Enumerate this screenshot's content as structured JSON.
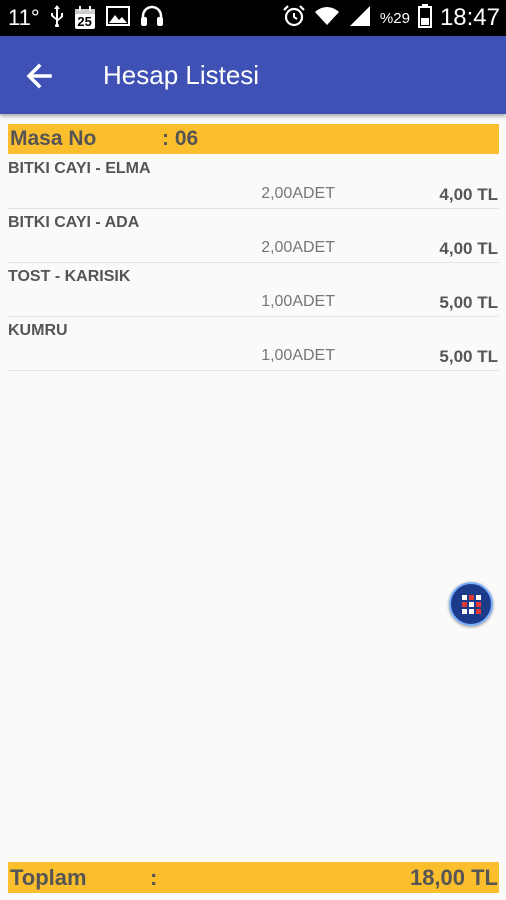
{
  "status_bar": {
    "temperature": "11°",
    "calendar_day": "25",
    "battery_percent": "%29",
    "time": "18:47"
  },
  "app_bar": {
    "title": "Hesap Listesi"
  },
  "masa": {
    "label": "Masa No",
    "value": ": 06"
  },
  "items": [
    {
      "name": "BITKI CAYI - ELMA",
      "qty": "2,00ADET",
      "price": "4,00 TL"
    },
    {
      "name": "BITKI CAYI - ADA",
      "qty": "2,00ADET",
      "price": "4,00 TL"
    },
    {
      "name": "TOST - KARISIK",
      "qty": "1,00ADET",
      "price": "5,00 TL"
    },
    {
      "name": "KUMRU",
      "qty": "1,00ADET",
      "price": "5,00 TL"
    }
  ],
  "total": {
    "label": "Toplam",
    "colon": ":",
    "value": "18,00 TL"
  },
  "colors": {
    "app_bar": "#3f51b5",
    "highlight": "#fbbf2e"
  }
}
